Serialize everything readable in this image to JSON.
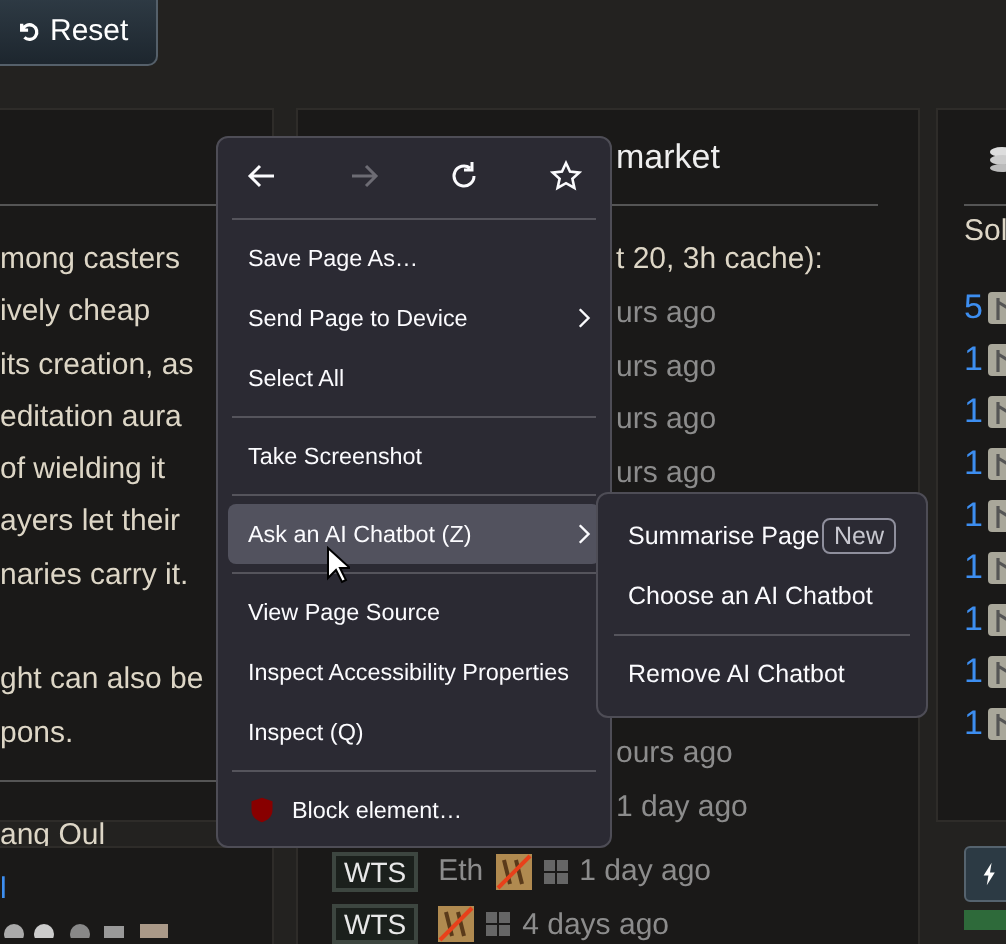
{
  "reset_button": {
    "label": "Reset"
  },
  "left_panel": {
    "paragraphs": [
      [
        "mong casters",
        "ively cheap",
        "its creation, as",
        "editation aura",
        "of wielding it",
        "ayers let their",
        "naries carry it."
      ],
      [
        "ght can also be",
        "pons."
      ]
    ],
    "footer": "ang Oul"
  },
  "left_panel_2": {
    "title": "l"
  },
  "middle_panel": {
    "title": "market",
    "subtitle": "t 20, 3h cache):",
    "rows": [
      {
        "kind": "time",
        "time": "urs ago"
      },
      {
        "kind": "time",
        "time": "urs ago"
      },
      {
        "kind": "time",
        "time": "urs ago"
      },
      {
        "kind": "time",
        "time": "urs ago"
      }
    ],
    "rows_below_submenu": [
      {
        "kind": "time",
        "time": "ours ago"
      },
      {
        "kind": "time",
        "time": "1 day ago"
      },
      {
        "kind": "listing",
        "tag": "WTS",
        "name": "Eth",
        "time": "1 day ago"
      },
      {
        "kind": "listing",
        "tag": "WTS",
        "time": "4 days ago"
      }
    ]
  },
  "right_panel": {
    "title": "Sol",
    "counts": [
      "5",
      "1",
      "1",
      "1",
      "1",
      "1",
      "1",
      "1",
      "1"
    ]
  },
  "context_menu": {
    "nav": [
      {
        "kind": "back",
        "disabled": false
      },
      {
        "kind": "forward",
        "disabled": true
      },
      {
        "kind": "reload",
        "disabled": false
      },
      {
        "kind": "bookmark",
        "disabled": false
      }
    ],
    "groups": [
      [
        {
          "label": "Save Page As…",
          "kind": "plain",
          "has_submenu": false,
          "selected": false
        },
        {
          "label": "Send Page to Device",
          "kind": "plain",
          "has_submenu": true,
          "selected": false
        },
        {
          "label": "Select All",
          "kind": "plain",
          "has_submenu": false,
          "selected": false
        }
      ],
      [
        {
          "label": "Take Screenshot",
          "kind": "plain",
          "has_submenu": false,
          "selected": false
        }
      ],
      [
        {
          "label": "Ask an AI Chatbot (Z)",
          "kind": "plain",
          "has_submenu": true,
          "selected": true
        }
      ],
      [
        {
          "label": "View Page Source",
          "kind": "plain",
          "has_submenu": false,
          "selected": false
        },
        {
          "label": "Inspect Accessibility Properties",
          "kind": "plain",
          "has_submenu": false,
          "selected": false
        },
        {
          "label": "Inspect (Q)",
          "kind": "plain",
          "has_submenu": false,
          "selected": false
        }
      ],
      [
        {
          "label": "Block element…",
          "kind": "addon",
          "has_submenu": false,
          "selected": false
        }
      ]
    ]
  },
  "submenu": {
    "groups": [
      [
        {
          "label": "Summarise Page",
          "badge": "New"
        },
        {
          "label": "Choose an AI Chatbot"
        }
      ],
      [
        {
          "label": "Remove AI Chatbot"
        }
      ]
    ]
  }
}
